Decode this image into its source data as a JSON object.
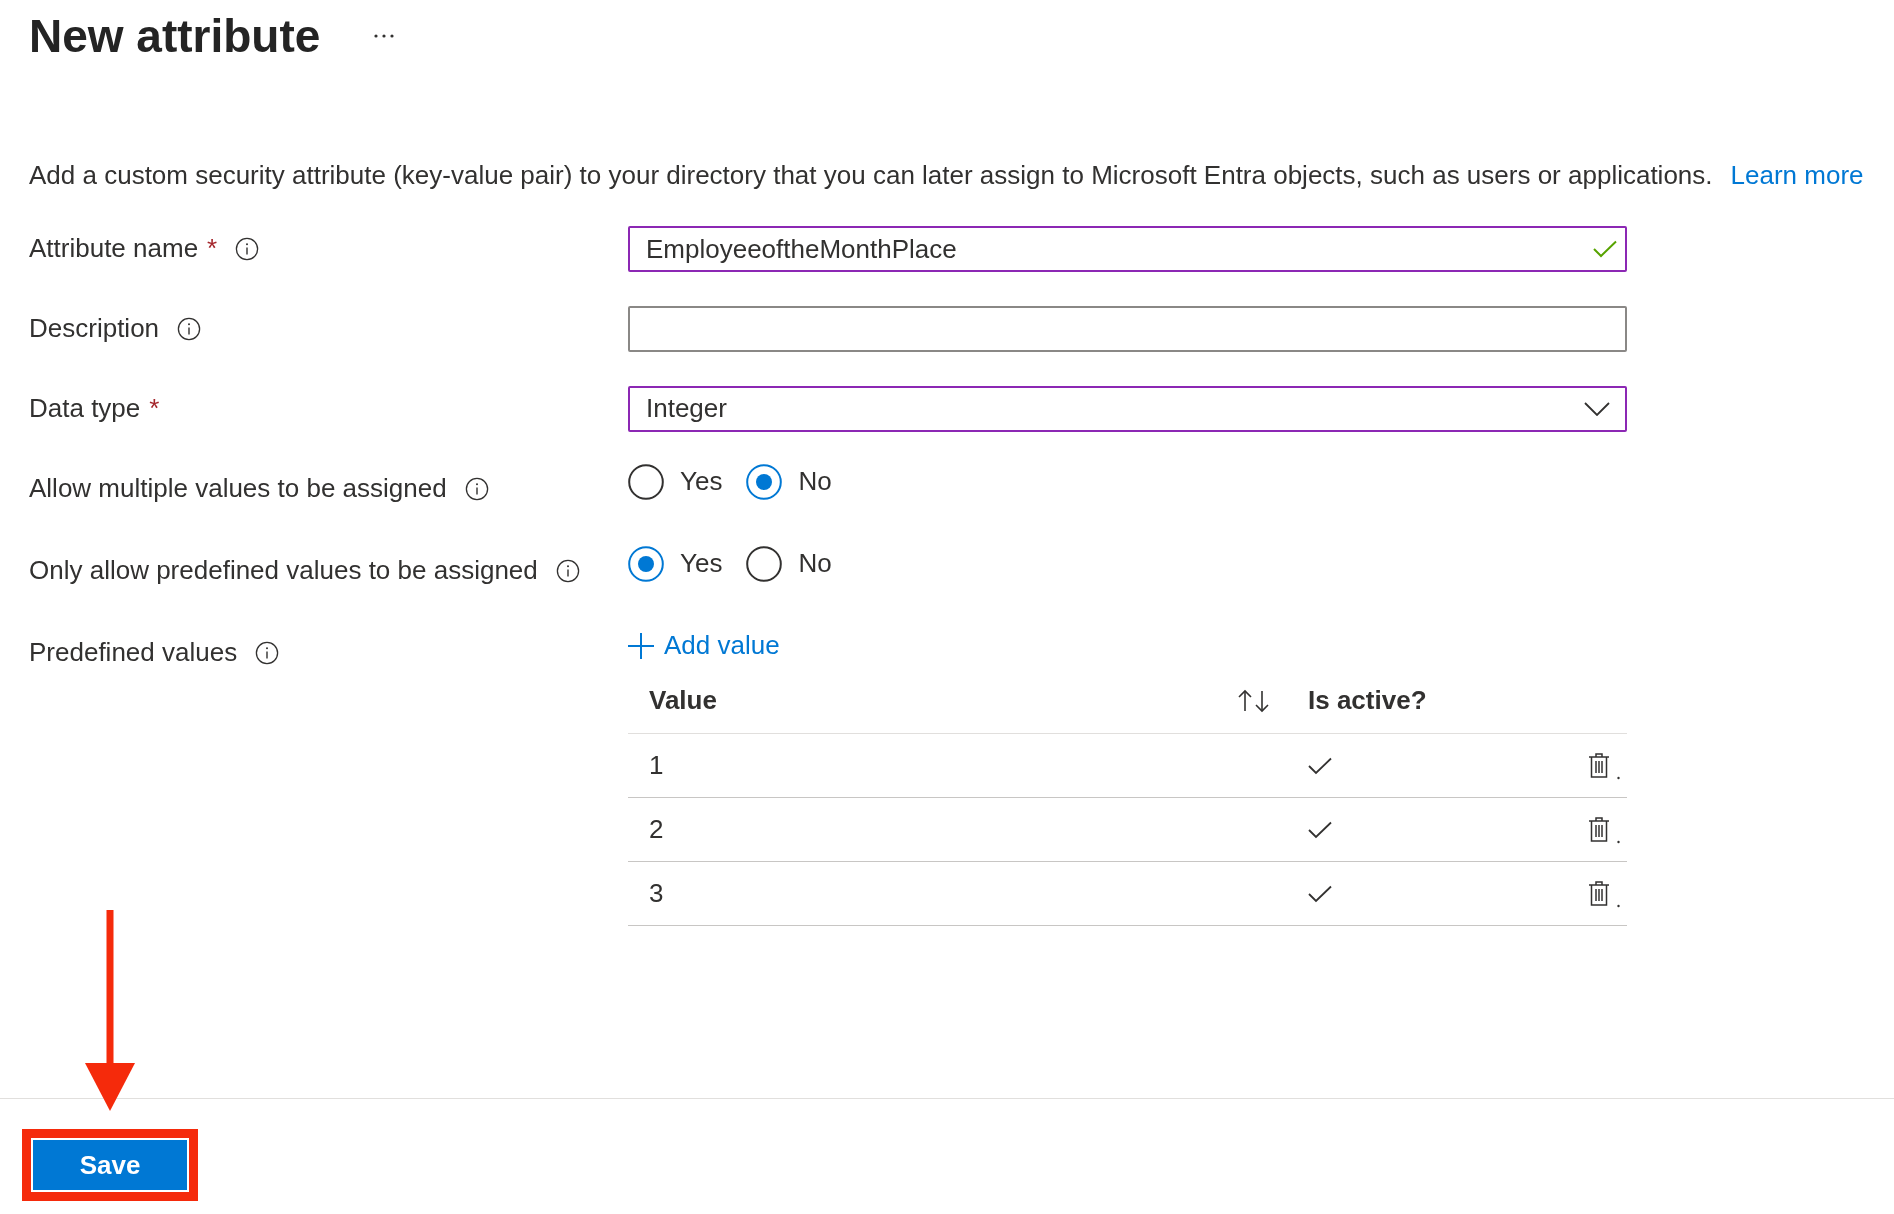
{
  "header": {
    "title": "New attribute"
  },
  "intro": {
    "text": "Add a custom security attribute (key-value pair) to your directory that you can later assign to Microsoft Entra objects, such as users or applications.",
    "link": "Learn more"
  },
  "fields": [
    {
      "kind": "text",
      "label": "Attribute name",
      "required_mark": "*",
      "info": true,
      "value": "EmployeeoftheMonthPlace",
      "highlighted": true,
      "valid": true
    },
    {
      "kind": "text",
      "label": "Description",
      "info": true,
      "highlighted": false
    },
    {
      "kind": "select",
      "label": "Data type",
      "required_mark": "*",
      "value": "Integer",
      "highlighted": true
    },
    {
      "kind": "radio",
      "label": "Allow multiple values to be assigned",
      "info": true,
      "options": [
        {
          "label": "Yes",
          "selected": false
        },
        {
          "label": "No",
          "selected": true
        }
      ]
    },
    {
      "kind": "radio",
      "label": "Only allow predefined values to be assigned",
      "info": true,
      "options": [
        {
          "label": "Yes",
          "selected": true
        },
        {
          "label": "No",
          "selected": false
        }
      ]
    },
    {
      "kind": "values",
      "label": "Predefined values",
      "info": true,
      "add_label": "Add value",
      "columns": [
        {
          "label": "Value",
          "sortable": true
        },
        {
          "label": "Is active?"
        }
      ],
      "rows": [
        {
          "value": "1",
          "active": true
        },
        {
          "value": "2",
          "active": true
        },
        {
          "value": "3",
          "active": true
        }
      ]
    }
  ],
  "footer": {
    "button": "Save",
    "marked": true
  }
}
